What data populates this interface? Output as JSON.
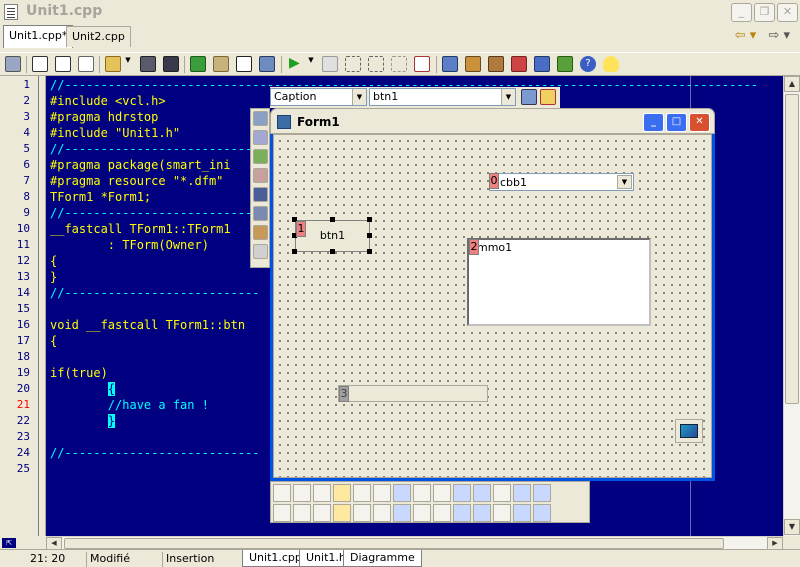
{
  "window": {
    "title": "Unit1.cpp"
  },
  "tabs": [
    {
      "label": "Unit1.cpp*"
    },
    {
      "label": "Unit2.cpp"
    }
  ],
  "tab_nav": {
    "back": "⇦ ▾",
    "forward": "⇨ ▾"
  },
  "editor": {
    "line_numbers": [
      "1",
      "2",
      "3",
      "4",
      "5",
      "6",
      "7",
      "8",
      "9",
      "10",
      "11",
      "12",
      "13",
      "14",
      "15",
      "16",
      "17",
      "18",
      "19",
      "20",
      "21",
      "22",
      "23",
      "24",
      "25"
    ],
    "error_line": "21",
    "lines": [
      "//------------------------------------------------------------------------------------------------",
      "#include <vcl.h>",
      "#pragma hdrstop",
      "#include \"Unit1.h\"",
      "//---------------------------",
      "#pragma package(smart_ini",
      "#pragma resource \"*.dfm\"",
      "TForm1 *Form1;",
      "//---------------------------",
      "__fastcall TForm1::TForm1",
      "        : TForm(Owner)",
      "{",
      "}",
      "//---------------------------",
      "",
      "void __fastcall TForm1::btn",
      "{",
      "",
      "if(true)",
      "        {",
      "        //have a fan !",
      "        }",
      "}",
      "//---------------------------",
      ""
    ]
  },
  "object_inspector": {
    "property_value": "Caption",
    "component_value": "btn1"
  },
  "form": {
    "title": "Form1",
    "button_caption": "btn1",
    "combo_text": "cbb1",
    "memo_text": "mmo1",
    "tab_orders": {
      "button": "1",
      "combo": "0",
      "memo": "2",
      "progress": "3"
    }
  },
  "status": {
    "position": "21: 20",
    "modified": "Modifié",
    "mode": "Insertion",
    "file_tabs": [
      "Unit1.cpp",
      "Unit1.h",
      "Diagramme"
    ]
  },
  "icons": {
    "toolbar": [
      "open-icon",
      "new-icon",
      "new-file-icon",
      "open-folder-icon",
      "save-icon",
      "save-all-icon",
      "build-icon",
      "add-file-icon",
      "remove-file-icon",
      "checkbox-icon",
      "compile-icon",
      "run-icon",
      "pause-icon",
      "trace-icon",
      "step-icon",
      "program-reset-icon",
      "toggle-form-icon",
      "package-icon",
      "component-icon",
      "database-icon",
      "debug-icon",
      "help-icon",
      "tip-icon"
    ]
  }
}
